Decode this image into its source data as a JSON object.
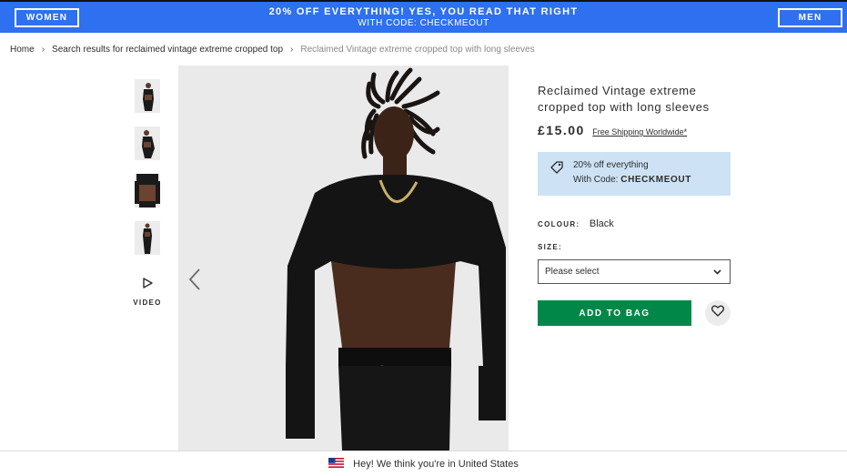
{
  "promo_bar": {
    "women_label": "WOMEN",
    "men_label": "MEN",
    "line1": "20% OFF EVERYTHING! YES, YOU READ THAT RIGHT",
    "line2": "WITH CODE: CHECKMEOUT",
    "background_color": "#2e70f0"
  },
  "breadcrumb": {
    "items": [
      "Home",
      "Search results for reclaimed vintage extreme cropped top",
      "Reclaimed Vintage extreme cropped top with long sleeves"
    ],
    "separator": "›"
  },
  "gallery": {
    "thumbnails": [
      "front-view",
      "side-view",
      "crop-closeup",
      "full-body"
    ],
    "video_label": "VIDEO",
    "icons": {
      "video": "play-triangle-icon",
      "prev": "chevron-left-icon"
    }
  },
  "product": {
    "title": "Reclaimed Vintage extreme cropped top with long sleeves",
    "price": "£15.00",
    "shipping_link": "Free Shipping Worldwide*",
    "promo_line1": "20% off everything",
    "promo_line2_prefix": "With Code:",
    "promo_code": "CHECKMEOUT",
    "colour_label": "COLOUR:",
    "colour_value": "Black",
    "size_label": "SIZE:",
    "size_placeholder": "Please select",
    "add_to_bag_label": "ADD TO BAG",
    "accent_color": "#018849",
    "promo_box_color": "#cde2f5"
  },
  "geo_bar": {
    "text": "Hey! We think you're in United States",
    "flag_icon": "us-flag-icon"
  }
}
